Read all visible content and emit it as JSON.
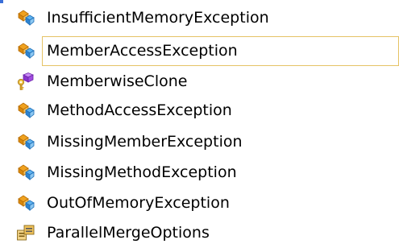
{
  "colors": {
    "selection_border": "#e5c365",
    "class_icon_orange": "#f0a21f",
    "class_icon_blue": "#2e83d0",
    "method_icon_purple": "#a24de0",
    "method_icon_gold": "#d8a326",
    "enum_icon_gold": "#d9a83a",
    "enum_icon_dark": "#5a5a5a"
  },
  "items": [
    {
      "label": "InsufficientMemoryException",
      "icon": "exception-class-icon",
      "selected": false
    },
    {
      "label": "MemberAccessException",
      "icon": "exception-class-icon",
      "selected": true
    },
    {
      "label": "MemberwiseClone",
      "icon": "protected-method-icon",
      "selected": false
    },
    {
      "label": "MethodAccessException",
      "icon": "exception-class-icon",
      "selected": false
    },
    {
      "label": "MissingMemberException",
      "icon": "exception-class-icon",
      "selected": false
    },
    {
      "label": "MissingMethodException",
      "icon": "exception-class-icon",
      "selected": false
    },
    {
      "label": "OutOfMemoryException",
      "icon": "exception-class-icon",
      "selected": false
    },
    {
      "label": "ParallelMergeOptions",
      "icon": "enum-icon",
      "selected": false
    }
  ]
}
